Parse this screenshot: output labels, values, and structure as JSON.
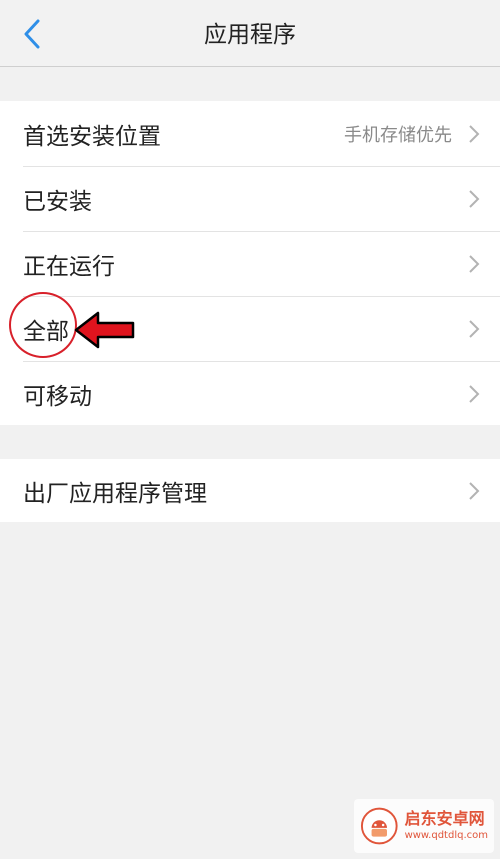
{
  "header": {
    "title": "应用程序",
    "back_icon": "chevron-left-icon",
    "accent": "#2f8fe8"
  },
  "groups": [
    {
      "items": [
        {
          "label": "首选安装位置",
          "value": "手机存储优先"
        },
        {
          "label": "已安装",
          "value": ""
        },
        {
          "label": "正在运行",
          "value": ""
        },
        {
          "label": "全部",
          "value": ""
        },
        {
          "label": "可移动",
          "value": ""
        }
      ]
    },
    {
      "items": [
        {
          "label": "出厂应用程序管理",
          "value": ""
        }
      ]
    }
  ],
  "annotation": {
    "target": "全部",
    "color": "#d8202a",
    "shapes": [
      "circle",
      "arrow-left"
    ]
  },
  "watermark": {
    "name": "启东安卓网",
    "url": "www.qdtdlq.com"
  }
}
